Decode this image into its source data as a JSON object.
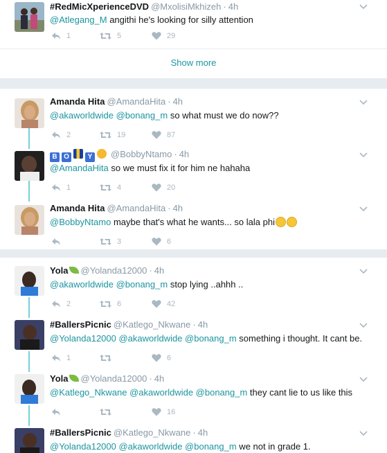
{
  "colors": {
    "accent": "#1b95a0",
    "thread_line": "#75d1d9",
    "muted": "#8899a6",
    "icon": "#aab8c2"
  },
  "show_more": "Show more",
  "tweets": [
    {
      "fullname": "#RedMicXperienceDVD",
      "username": "@MxolisiMkhizeh",
      "time": "4h",
      "mention": "@Atlegang_M",
      "body": " angithi he's looking for silly attention",
      "replies": "1",
      "retweets": "5",
      "likes": "29"
    },
    {
      "fullname": "Amanda Hita",
      "username": "@AmandaHita",
      "time": "4h",
      "mention": "@akaworldwide @bonang_m",
      "body": " so what must we do now??",
      "replies": "2",
      "retweets": "19",
      "likes": "87"
    },
    {
      "name_chips": [
        "B",
        "O",
        "Y"
      ],
      "username": "@BobbyNtamo",
      "time": "4h",
      "mention": "@AmandaHita",
      "body": " so we must fix it for him ne hahaha",
      "replies": "1",
      "retweets": "4",
      "likes": "20"
    },
    {
      "fullname": "Amanda Hita",
      "username": "@AmandaHita",
      "time": "4h",
      "mention": "@BobbyNtamo",
      "body": " maybe that's what he wants... so lala phi",
      "replies": "",
      "retweets": "3",
      "likes": "6"
    },
    {
      "fullname": "Yola",
      "username": "@Yolanda12000",
      "time": "4h",
      "mention": "@akaworldwide @bonang_m",
      "body": " stop lying ..ahhh ..",
      "replies": "2",
      "retweets": "6",
      "likes": "42"
    },
    {
      "fullname": "#BallersPicnic",
      "username": "@Katlego_Nkwane",
      "time": "4h",
      "mention": "@Yolanda12000 @akaworldwide @bonang_m",
      "body": " something i thought. It cant be.",
      "replies": "1",
      "retweets": "",
      "likes": "6"
    },
    {
      "fullname": "Yola",
      "username": "@Yolanda12000",
      "time": "4h",
      "mention": "@Katlego_Nkwane @akaworldwide @bonang_m",
      "body": " they cant lie to us like this",
      "replies": "",
      "retweets": "",
      "likes": "16"
    },
    {
      "fullname": "#BallersPicnic",
      "username": "@Katlego_Nkwane",
      "time": "4h",
      "mention": "@Yolanda12000 @akaworldwide @bonang_m",
      "body": " we not in grade 1.",
      "replies": "",
      "retweets": "",
      "likes": ""
    }
  ]
}
